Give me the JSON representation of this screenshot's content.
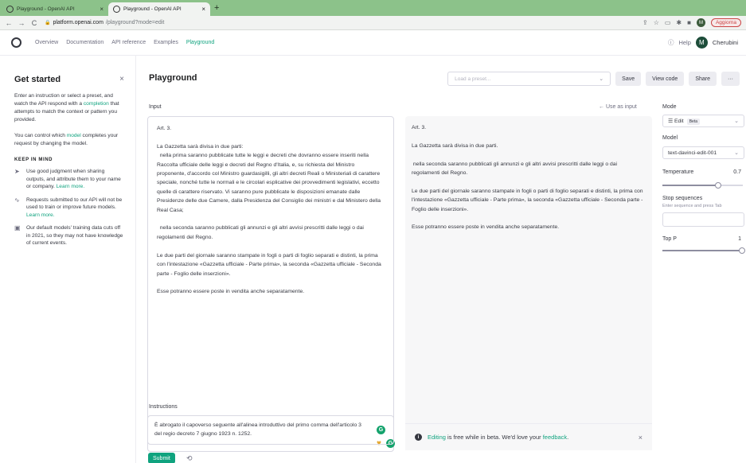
{
  "browser": {
    "tabs": [
      {
        "title": "Playground - OpenAI API"
      },
      {
        "title": "Playground - OpenAI API"
      }
    ],
    "url_domain": "platform.openai.com",
    "url_path": "/playground?mode=edit",
    "update_label": "Aggiorna",
    "profile_initial": "M"
  },
  "header": {
    "nav": [
      "Overview",
      "Documentation",
      "API reference",
      "Examples",
      "Playground"
    ],
    "help_label": "Help",
    "user_initial": "M",
    "user_name": "Cherubini"
  },
  "sidebar": {
    "title": "Get started",
    "intro_1": "Enter an instruction or select a preset, and watch the API respond with a ",
    "intro_link": "completion",
    "intro_2": " that attempts to match the context or pattern you provided.",
    "control_1": "You can control which ",
    "control_link": "model",
    "control_2": " completes your request by changing the model.",
    "keep_in_mind": "KEEP IN MIND",
    "items": [
      {
        "text": "Use good judgment when sharing outputs, and attribute them to your name or company. ",
        "link": "Learn more."
      },
      {
        "text": "Requests submitted to our API will not be used to train or improve future models. ",
        "link": "Learn more."
      },
      {
        "text": "Our default models' training data cuts off in 2021, so they may not have knowledge of current events.",
        "link": ""
      }
    ]
  },
  "main": {
    "title": "Playground",
    "preset_placeholder": "Load a preset...",
    "save_label": "Save",
    "view_code_label": "View code",
    "share_label": "Share",
    "more_label": "···",
    "input_label": "Input",
    "use_as_input": "← Use as input",
    "input_paragraphs": [
      "Art. 3.",
      "La Gazzetta sarà divisa in due parti:\n  nella prima saranno pubblicate tutte le leggi e decreti che dovranno essere inseriti nella Raccolta ufficiale delle leggi e decreti del Regno d'Italia, e, su richiesta del Ministro proponente, d'accordo col Ministro guardasigilli, gli altri decreti Reali o Ministeriali di carattere speciale, nonché tutte le normali e le circolari esplicative dei provvedimenti legislativi, eccetto quelle di carattere riservato. Vi saranno pure pubblicate le disposizioni emanate dalle Presidenze delle due Camere, dalla Presidenza del Consiglio dei ministri e dal Ministero della Real Casa;",
      "  nella seconda saranno pubblicati gli annunzi e gli altri avvisi prescritti dalle leggi o dai regolamenti del Regno.",
      "Le due parti del giornale saranno stampate in fogli o parti di foglio separati e distinti, la prima con l'intestazione «Gazzetta ufficiale - Parte prima», la seconda «Gazzetta ufficiale - Seconda parte - Foglio delle inserzioni».",
      "Esse potranno essere poste in vendita anche separatamente."
    ],
    "output_paragraphs": [
      "Art. 3.",
      "La Gazzetta sarà divisa in due parti.",
      " nella seconda saranno pubblicati gli annunzi e gli altri avvisi prescritti dalle leggi o dai regolamenti del Regno.",
      "Le due parti del giornale saranno stampate in fogli o parti di foglio separati e distinti, la prima con l'intestazione «Gazzetta ufficiale - Parte prima», la seconda «Gazzetta ufficiale - Seconda parte - Foglio delle inserzioni».",
      "Esse potranno essere poste in vendita anche separatamente."
    ],
    "instructions_label": "Instructions",
    "instructions_text": "È abrogato il capoverso seguente all'alinea introduttivo del primo comma dell'articolo 3 del regio decreto 7 giugno 1923 n. 1252.",
    "submit_label": "Submit",
    "notice_link": "Editing",
    "notice_mid": " is free while in beta. We'd love your ",
    "notice_link2": "feedback",
    "notice_end": "."
  },
  "settings": {
    "mode_label": "Mode",
    "mode_value": "Edit",
    "mode_badge": "Beta",
    "model_label": "Model",
    "model_value": "text-davinci-edit-001",
    "temperature_label": "Temperature",
    "temperature_value": "0.7",
    "temperature_level": 0.7,
    "stop_label": "Stop sequences",
    "stop_hint": "Enter sequence and press Tab",
    "top_p_label": "Top P",
    "top_p_value": "1",
    "top_p_level": 1.0
  },
  "colors": {
    "accent": "#10a37f",
    "tabbar": "#8cc28a"
  }
}
